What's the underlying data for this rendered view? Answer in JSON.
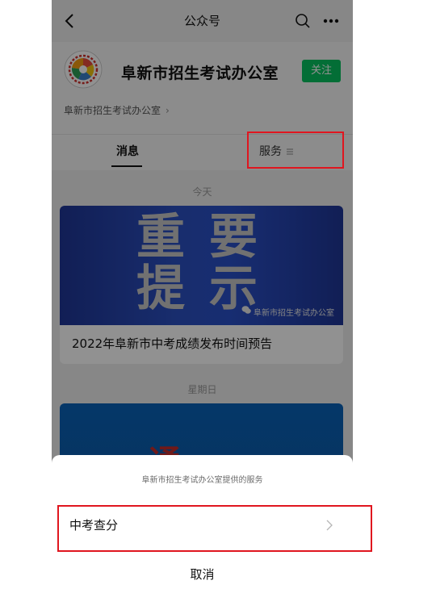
{
  "header": {
    "title": "公众号"
  },
  "profile": {
    "account_name": "阜新市招生考试办公室",
    "follow_label": "关注",
    "sub_link": "阜新市招生考试办公室",
    "sub_link_chevron": "›"
  },
  "tabs": {
    "messages": "消息",
    "services": "服务"
  },
  "feed": {
    "date_today": "今天",
    "card1": {
      "banner_line1": "重要",
      "banner_line2": "提示",
      "watermark": "阜新市招生考试办公室",
      "title": "2022年阜新市中考成绩发布时间预告"
    },
    "date_sunday": "星期日",
    "card2": {
      "partial_text": "通 知"
    }
  },
  "sheet": {
    "title": "阜新市招生考试办公室提供的服务",
    "item_label": "中考查分",
    "cancel_label": "取消"
  },
  "colors": {
    "accent_green": "#07c160",
    "highlight_red": "#e0161f",
    "banner_blue": "#2b4fc0"
  },
  "icons": [
    "back-icon",
    "search-icon",
    "more-icon",
    "menu-lines-icon",
    "wechat-icon",
    "chevron-right-icon"
  ]
}
